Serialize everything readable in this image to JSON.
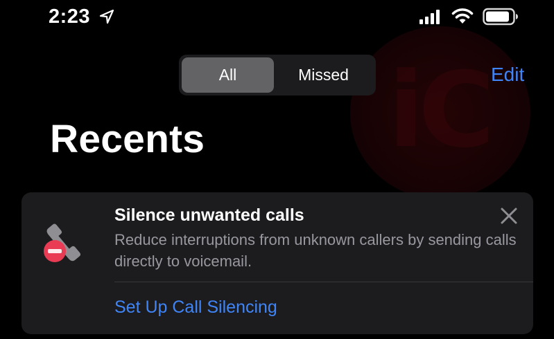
{
  "status_bar": {
    "time": "2:23",
    "icons": [
      "location-arrow-icon",
      "cellular-signal-icon",
      "wifi-icon",
      "battery-icon"
    ]
  },
  "segments": {
    "all_label": "All",
    "missed_label": "Missed",
    "selected": "All"
  },
  "header": {
    "edit_label": "Edit",
    "title": "Recents"
  },
  "card": {
    "title": "Silence unwanted calls",
    "description": "Reduce interruptions from unknown callers by sending calls directly to voicemail.",
    "action_label": "Set Up Call Silencing",
    "icon": "phone-blocked-icon",
    "close_icon": "close-icon"
  },
  "watermark": {
    "text": "iC"
  },
  "colors": {
    "background": "#000000",
    "card_background": "#1c1c1e",
    "accent_blue": "#3f85f7",
    "secondary_text": "#98989f",
    "segment_selected": "#636366",
    "block_red": "#ea3b54"
  }
}
